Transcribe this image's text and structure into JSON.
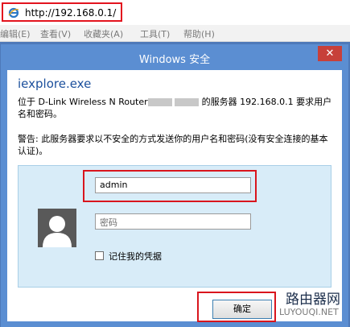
{
  "browser": {
    "url": "http://192.168.0.1/",
    "menu": [
      "编辑(E)",
      "查看(V)",
      "收藏夹(A)",
      "工具(T)",
      "帮助(H)"
    ]
  },
  "dialog": {
    "title": "Windows 安全",
    "close_symbol": "✕",
    "app_name": "iexplore.exe",
    "description_prefix": "位于 D-Link Wireless N Router",
    "description_suffix": " 的服务器 192.168.0.1 要求用户名和密码。",
    "warning": "警告: 此服务器要求以不安全的方式发送你的用户名和密码(没有安全连接的基本认证)。",
    "username_value": "admin",
    "password_placeholder": "密码",
    "remember_label": "记住我的凭据",
    "ok_label": "确定"
  },
  "watermark": {
    "line1": "路由器网",
    "line2": "LUYOUQI.NET"
  },
  "colors": {
    "dialog_bg": "#5b8ed2",
    "highlight": "#d9151d",
    "panel_bg": "#d8ecf8"
  }
}
